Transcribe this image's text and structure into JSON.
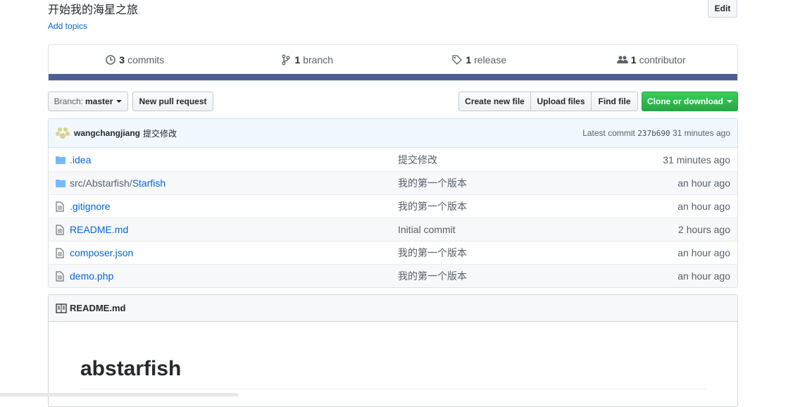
{
  "repo": {
    "description": "开始我的海星之旅",
    "add_topics": "Add topics",
    "edit_label": "Edit"
  },
  "summary": {
    "commits": {
      "count": "3",
      "label": "commits"
    },
    "branches": {
      "count": "1",
      "label": "branch"
    },
    "releases": {
      "count": "1",
      "label": "release"
    },
    "contributors": {
      "count": "1",
      "label": "contributor"
    },
    "language_color": "#4f5d95"
  },
  "toolbar": {
    "branch_prefix": "Branch:",
    "branch_name": "master",
    "new_pull_request": "New pull request",
    "create_new_file": "Create new file",
    "upload_files": "Upload files",
    "find_file": "Find file",
    "clone_or_download": "Clone or download"
  },
  "latest_commit": {
    "author": "wangchangjiang",
    "message": "提交修改",
    "label": "Latest commit",
    "sha": "237b690",
    "age": "31 minutes ago"
  },
  "files": [
    {
      "type": "dir",
      "name": ".idea",
      "dir_prefix": "",
      "message": "提交修改",
      "age": "31 minutes ago"
    },
    {
      "type": "dir",
      "name": "Starfish",
      "dir_prefix": "src/Abstarfish/",
      "message": "我的第一个版本",
      "age": "an hour ago"
    },
    {
      "type": "file",
      "name": ".gitignore",
      "dir_prefix": "",
      "message": "我的第一个版本",
      "age": "an hour ago"
    },
    {
      "type": "file",
      "name": "README.md",
      "dir_prefix": "",
      "message": "Initial commit",
      "age": "2 hours ago"
    },
    {
      "type": "file",
      "name": "composer.json",
      "dir_prefix": "",
      "message": "我的第一个版本",
      "age": "an hour ago"
    },
    {
      "type": "file",
      "name": "demo.php",
      "dir_prefix": "",
      "message": "我的第一个版本",
      "age": "an hour ago"
    }
  ],
  "readme": {
    "filename": "README.md",
    "heading": "abstarfish"
  },
  "colors": {
    "link": "#0366d6",
    "green_button": "#28a745",
    "commit_bg": "#f1f8ff"
  }
}
